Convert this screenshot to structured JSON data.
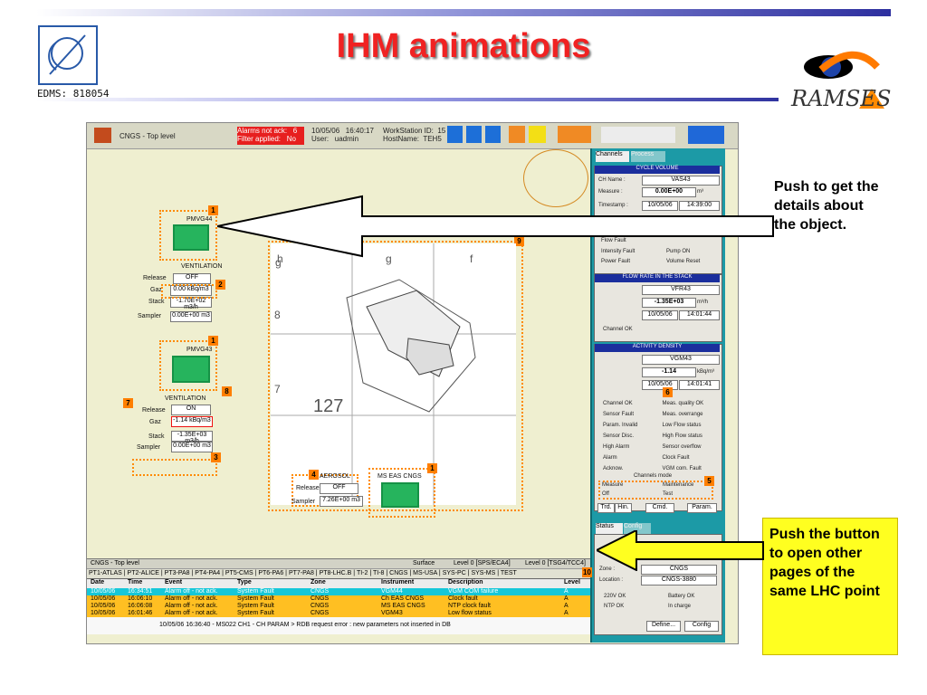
{
  "header": {
    "title": "IHM animations",
    "doc_id": "EDMS: 818054",
    "logos": [
      "cern-logo",
      "ramses-logo"
    ],
    "ramses_text": "RAMSES"
  },
  "screen": {
    "app_title": "CNGS - Top level",
    "alarm_text": "Alarms not ack:   6\nFilter applied:   No",
    "datetime_user": "10/05/06   16:40:17\nUser:   uadmin",
    "station": "WorkStation ID:  15\nHostName:  TEH5",
    "nav": [
      "Back",
      "Fwd",
      "Up"
    ],
    "left": {
      "pmv44": "PMVG44",
      "vent1": "VENTILATION",
      "release1": "Release",
      "release1_val": "OFF",
      "gaz1": "Gaz",
      "gaz1_val": "0.00 kBq/m3",
      "stack1": "Stack",
      "stack1_val": "-1.70E+02 m3/h",
      "sampler1": "Sampler",
      "sampler1_val": "0.00E+00 m3",
      "pmv43": "PMVG43",
      "vent2": "VENTILATION",
      "release2": "Release",
      "release2_val": "ON",
      "gaz2": "Gaz",
      "gaz2_val": "-1.14 kBq/m3",
      "stack2": "Stack",
      "stack2_val": "-1.35E+03 m3/h",
      "sampler2": "Sampler",
      "sampler2_val": "0.00E+00 m3",
      "aerosol": "AEROSOL",
      "release3": "Release",
      "release3_val": "OFF",
      "sampler3": "Sampler",
      "sampler3_val": "7.26E+00 m3",
      "ms_eas": "MS EAS CNGS"
    },
    "map": {
      "h": "h",
      "g": "g",
      "f": "f",
      "g2": "g",
      "v8": "8",
      "v7": "7",
      "num": "127"
    },
    "right": {
      "tabs": [
        "Channels",
        "Process"
      ],
      "cycle_title": "CYCLE VOLUME",
      "ch1": "VAS43",
      "measure1": "0.00E+00",
      "unit1": "m³",
      "timestamp1": "10/05/06",
      "time1": "14:39:00",
      "flow_flags": [
        "Flow Fault",
        "Intensity Fault",
        "Pump ON",
        "Power Fault",
        "Volume Reset"
      ],
      "flow_title": "FLOW RATE IN THE STACK",
      "ch2": "VFR43",
      "measure2": "-1.35E+03",
      "unit2": "m³/h",
      "timestamp2": "10/05/06",
      "time2": "14:01:44",
      "channel_ok": "Channel OK",
      "activity_title": "ACTIVITY DENSITY",
      "ch3": "VGM43",
      "measure3": "-1.14",
      "unit3": "kBq/m³",
      "timestamp3": "10/05/06",
      "time3": "14:01:41",
      "activity_flags": [
        "Channel OK",
        "Meas. quality OK",
        "Sensor Fault",
        "Meas. overrange",
        "Param. Invalid",
        "Low Flow status",
        "Sensor Disc.",
        "High Flow status",
        "High Alarm",
        "Sensor overflow",
        "Alarm",
        "Clock Fault",
        "Acknow.",
        "VGM com. Fault"
      ],
      "mode_title": "Channels mode",
      "modes": [
        "Measure",
        "Maintenance",
        "Off",
        "Test"
      ],
      "buttons": [
        "Trd.",
        "Hin.",
        "Cmd.",
        "Param."
      ],
      "status_tabs": [
        "Status",
        "Config"
      ],
      "zone": "Zone :",
      "zone_val": "CNGS",
      "location": "Location :",
      "location_val": "CNGS-3880",
      "status_flags": [
        "220V OK",
        "Battery OK",
        "NTP OK",
        "In charge"
      ],
      "bottom_buttons": [
        "Define...",
        "Config"
      ]
    },
    "bottom": {
      "left_title": "CNGS - Top level",
      "surface": "Surface",
      "level0": "Level 0 [SPS/ECA4]",
      "level1": "Level 0 [TSG4/TCC4]",
      "tabs": [
        "PT1-ATLAS",
        "PT2-ALICE",
        "PT3-PA8",
        "PT4-PA4",
        "PT5-CMS",
        "PT6-PA6",
        "PT7-PA8",
        "PT8-LHC.B",
        "TI-2",
        "TI-8",
        "CNGS",
        "MS-USA",
        "SYS-PC",
        "SYS-MS",
        "TEST"
      ],
      "table_headers": [
        "Date",
        "Time",
        "Event",
        "Type",
        "Zone",
        "Instrument",
        "Description",
        "Level"
      ],
      "rows": [
        [
          "10/05/06",
          "16:34:51",
          "Alarm off - not ack.",
          "System Fault",
          "CNGS",
          "VGM44",
          "VGM COM failure",
          "A"
        ],
        [
          "10/05/06",
          "16:06:10",
          "Alarm off - not ack.",
          "System Fault",
          "CNGS",
          "Ch EAS CNGS",
          "Clock fault",
          "A"
        ],
        [
          "10/05/06",
          "16:06:08",
          "Alarm off - not ack.",
          "System Fault",
          "CNGS",
          "MS EAS CNGS",
          "NTP clock fault",
          "A"
        ],
        [
          "10/05/06",
          "16:01:46",
          "Alarm off - not ack.",
          "System Fault",
          "CNGS",
          "VGM43",
          "Low flow status",
          "A"
        ]
      ],
      "message": "10/05/06 16:36:40 - MS022 CH1 - CH PARAM > RDB request error : new parameters not inserted in DB"
    }
  },
  "callouts": {
    "details": "Push to get the details about the object.",
    "pages": "Push the button to open other pages of the same LHC point"
  }
}
